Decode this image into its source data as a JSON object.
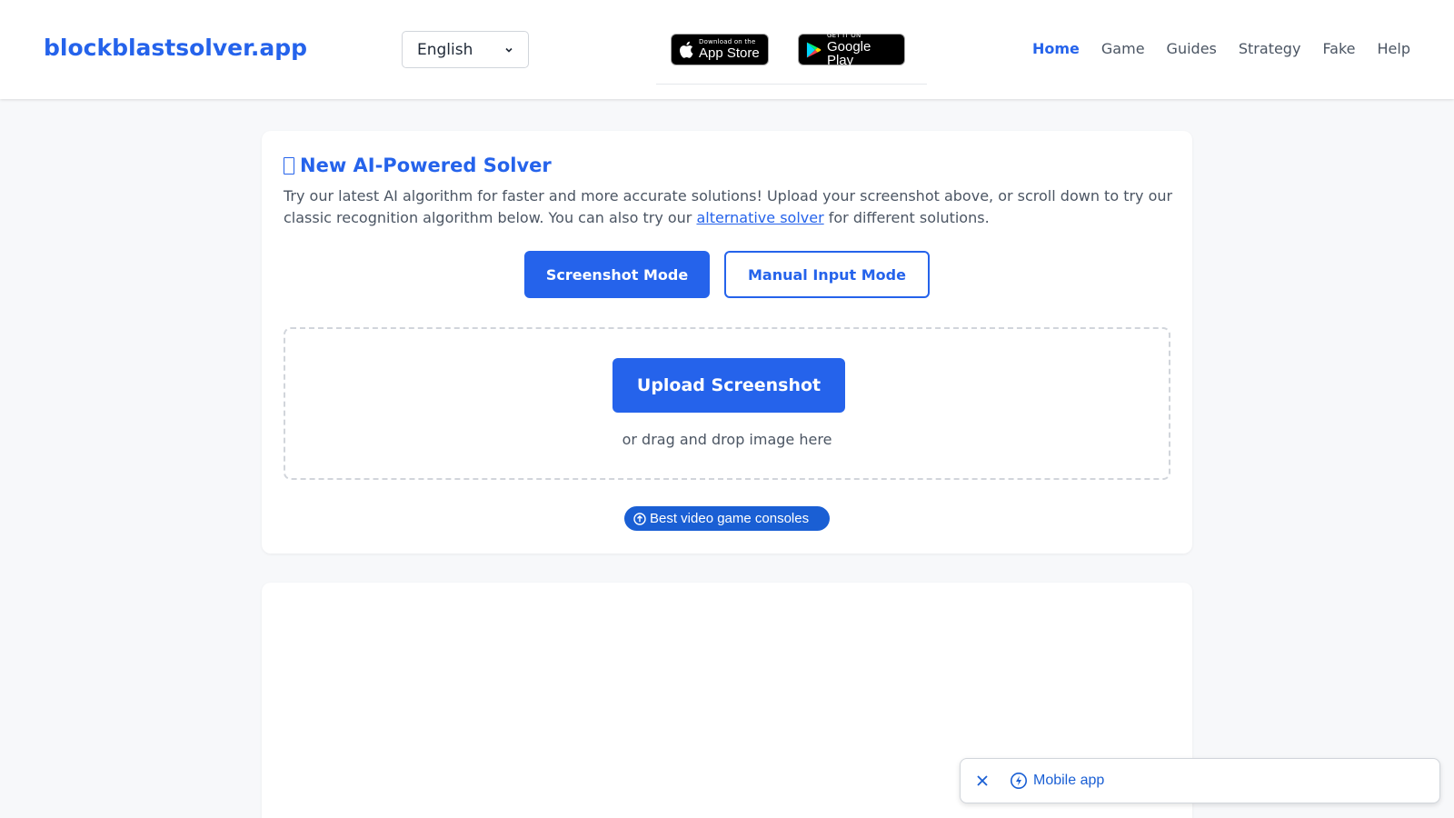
{
  "header": {
    "logo": "blockblastsolver.app",
    "language": {
      "selected": "English"
    },
    "badges": {
      "appstore_small": "Download on the",
      "appstore_big": "App Store",
      "gplay_small": "GET IT ON",
      "gplay_big": "Google Play"
    },
    "nav": [
      {
        "label": "Home",
        "active": true
      },
      {
        "label": "Game"
      },
      {
        "label": "Guides"
      },
      {
        "label": "Strategy"
      },
      {
        "label": "Fake"
      },
      {
        "label": "Help"
      }
    ]
  },
  "solver_card": {
    "title": "New AI-Powered Solver",
    "desc_before": "Try our latest AI algorithm for faster and more accurate solutions! Upload your screenshot above, or scroll down to try our classic recognition algorithm below. You can also try our ",
    "desc_link": "alternative solver",
    "desc_after": " for different solutions.",
    "modes": {
      "screenshot": "Screenshot Mode",
      "manual": "Manual Input Mode"
    },
    "upload_button": "Upload Screenshot",
    "drop_hint": "or drag and drop image here",
    "ad_pill": "Best video game consoles"
  },
  "mobile_bar": {
    "label": "Mobile app"
  },
  "colors": {
    "accent": "#2563eb",
    "ad_blue": "#1a5fd4",
    "background": "#f7f8fa"
  }
}
